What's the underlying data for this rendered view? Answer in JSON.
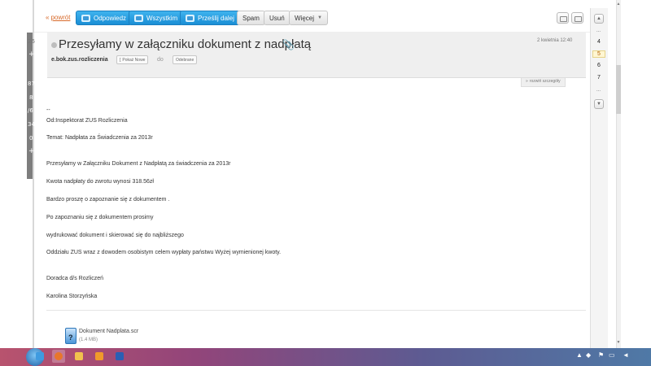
{
  "toolbar": {
    "back": "powrót",
    "reply": "Odpowiedz",
    "reply_all": "Wszystkim",
    "forward": "Prześlij dalej",
    "spam": "Spam",
    "delete": "Usuń",
    "more": "Więcej"
  },
  "message": {
    "subject": "Przesyłamy w załączniku dokument z nadpłatą",
    "date": "2 kwietnia 12:40",
    "sender": "e.bok.zus.rozliczenia",
    "show_new": "Pokaż Nowe",
    "to_label": "do",
    "folder_chip": "Odebrane",
    "details_link": "rozwiń szczegóły",
    "body": [
      "--",
      "Od:Inspektorat ZUS Rozliczenia",
      "Temat: Nadpłata za Świadczenia za 2013r",
      "Przesyłamy w Załączniku Dokument z Nadpłatą za świadczenia za 2013r",
      "Kwota nadpłaty do zwrotu wynosi 318.56zł",
      "Bardzo proszę o zapoznanie się z dokumentem .",
      "Po zapoznaniu się z dokumentem prosimy",
      "wydrukować dokument i skierować się do najbliższego",
      "Oddziału ZUS wraz z dowodem osobistym celem wypłaty państwu Wyżej wymienionej kwoty.",
      "Doradca d/s Rozliczeń",
      "Karolina Storzyńska"
    ]
  },
  "attachment": {
    "name": "Dokument Nadplata.scr",
    "size": "(1.4 MB)",
    "icon": "file-exe-icon"
  },
  "sidebar": {
    "dots_top": "...",
    "dots_bottom": "...",
    "pages": [
      "4",
      "5",
      "6",
      "7"
    ],
    "active_page": "5"
  },
  "left_strip": {
    "labels": [
      "26",
      "+",
      "87",
      "8",
      "/6",
      "34",
      "0",
      "+"
    ]
  },
  "colors": {
    "accent_blue": "#1a8ed5",
    "link_orange": "#d86b2c",
    "header_bg": "#efefef"
  }
}
